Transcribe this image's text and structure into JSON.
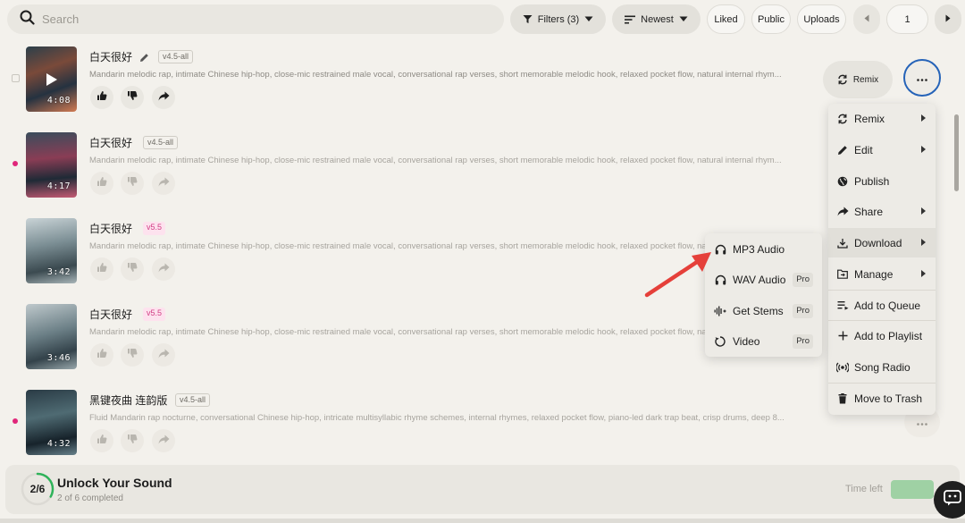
{
  "search": {
    "placeholder": "Search"
  },
  "toolbar": {
    "filters_label": "Filters (3)",
    "sort_label": "Newest",
    "liked_label": "Liked",
    "public_label": "Public",
    "uploads_label": "Uploads",
    "page_number": "1"
  },
  "songs": [
    {
      "title": "白天很好",
      "version": "v4.5-all",
      "badge_style": "gray",
      "duration": "4:08",
      "description": "Mandarin melodic rap, intimate Chinese hip-hop, close-mic restrained male vocal, conversational rap verses, short memorable melodic hook, relaxed pocket flow, natural internal rhym...",
      "selected": true,
      "unread": false
    },
    {
      "title": "白天很好",
      "version": "v4.5-all",
      "badge_style": "gray",
      "duration": "4:17",
      "description": "Mandarin melodic rap, intimate Chinese hip-hop, close-mic restrained male vocal, conversational rap verses, short memorable melodic hook, relaxed pocket flow, natural internal rhym...",
      "selected": false,
      "unread": true
    },
    {
      "title": "白天很好",
      "version": "v5.5",
      "badge_style": "pink",
      "duration": "3:42",
      "description": "Mandarin melodic rap, intimate Chinese hip-hop, close-mic restrained male vocal, conversational rap verses, short memorable melodic hook, relaxed pocket flow, natural internal rhym...",
      "selected": false,
      "unread": false
    },
    {
      "title": "白天很好",
      "version": "v5.5",
      "badge_style": "pink",
      "duration": "3:46",
      "description": "Mandarin melodic rap, intimate Chinese hip-hop, close-mic restrained male vocal, conversational rap verses, short memorable melodic hook, relaxed pocket flow, natural internal rhym...",
      "selected": false,
      "unread": false
    },
    {
      "title": "黑键夜曲 连韵版",
      "version": "v4.5-all",
      "badge_style": "gray",
      "duration": "4:32",
      "description": "Fluid Mandarin rap nocturne, conversational Chinese hip-hop, intricate multisyllabic rhyme schemes, internal rhymes, relaxed pocket flow, piano-led dark trap beat, crisp drums, deep 8...",
      "selected": false,
      "unread": true
    }
  ],
  "row_actions": {
    "remix_label": "Remix"
  },
  "context_menu": {
    "items": [
      {
        "label": "Remix",
        "icon": "remix-icon",
        "submenu": true
      },
      {
        "label": "Edit",
        "icon": "pencil-icon",
        "submenu": true
      },
      {
        "label": "Publish",
        "icon": "globe-icon",
        "submenu": false
      },
      {
        "label": "Share",
        "icon": "share-arrow-icon",
        "submenu": true
      },
      {
        "label": "Download",
        "icon": "download-icon",
        "submenu": true
      },
      {
        "label": "Manage",
        "icon": "folder-icon",
        "submenu": true
      },
      {
        "label": "Add to Queue",
        "icon": "queue-icon",
        "submenu": false
      },
      {
        "label": "Add to Playlist",
        "icon": "plus-icon",
        "submenu": false
      },
      {
        "label": "Song Radio",
        "icon": "radio-icon",
        "submenu": false
      },
      {
        "label": "Move to Trash",
        "icon": "trash-icon",
        "submenu": false
      }
    ]
  },
  "download_submenu": {
    "items": [
      {
        "label": "MP3 Audio",
        "icon": "headphones-icon",
        "tag": ""
      },
      {
        "label": "WAV Audio",
        "icon": "headphones-icon",
        "tag": "Pro"
      },
      {
        "label": "Get Stems",
        "icon": "waveform-icon",
        "tag": "Pro"
      },
      {
        "label": "Video",
        "icon": "video-icon",
        "tag": "Pro"
      }
    ]
  },
  "progress_panel": {
    "progress_text": "2/6",
    "completed_count": 2,
    "total_count": 6,
    "title": "Unlock Your Sound",
    "subtitle": "2 of 6 completed",
    "time_left_label": "Time left"
  },
  "colors": {
    "accent_blue": "#2563b8",
    "pink_dot": "#e0267a",
    "progress_green": "#2fb35a",
    "annotation_arrow": "#e5403a"
  }
}
